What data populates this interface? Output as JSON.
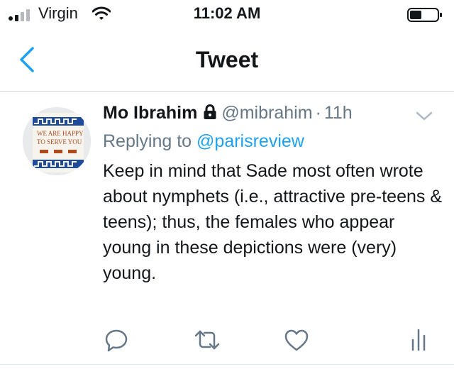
{
  "status_bar": {
    "carrier": "Virgin",
    "time": "11:02 AM",
    "icons": [
      "signal-icon",
      "wifi-icon",
      "battery-icon"
    ]
  },
  "nav": {
    "title": "Tweet",
    "back_icon": "chevron-left-icon"
  },
  "tweet": {
    "author_name": "Mo Ibrahim",
    "protected_icon": "lock-icon",
    "handle": "@mibrahim",
    "separator": "·",
    "time": "11h",
    "avatar_text": [
      "WE ARE HAPPY",
      "TO SERVE YOU"
    ],
    "replying_prefix": "Replying to",
    "replying_to": "@parisreview",
    "text": "Keep in mind that Sade most often wrote about nymphets (i.e., attractive pre-teens & teens); thus, the females who appear young in these depictions were (very) young.",
    "actions": [
      "reply-icon",
      "retweet-icon",
      "like-icon",
      "analytics-icon"
    ]
  },
  "colors": {
    "accent": "#1da1f2",
    "secondary_text": "#657786",
    "primary_text": "#14171a",
    "divider": "#cfd4d8"
  }
}
